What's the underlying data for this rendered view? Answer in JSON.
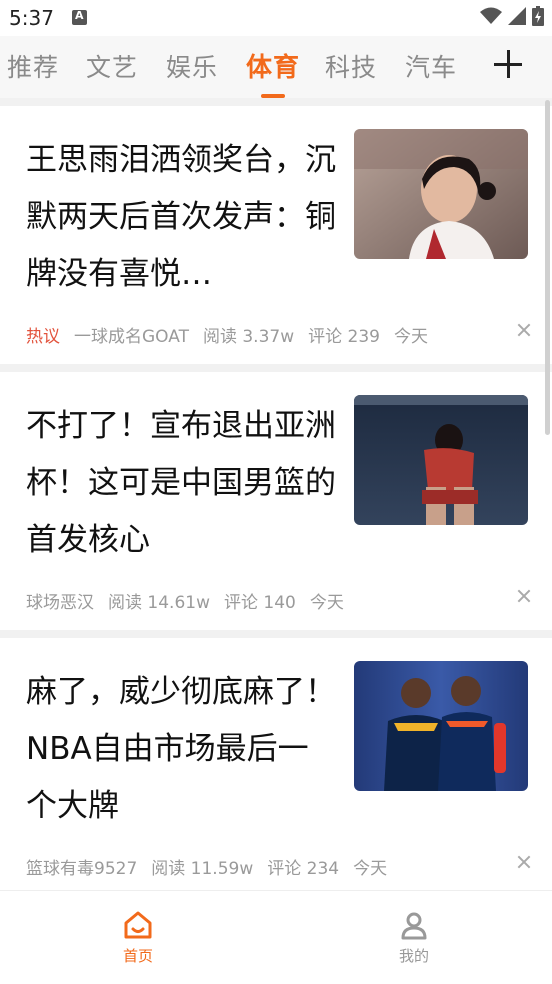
{
  "status": {
    "time": "5:37"
  },
  "tabs": [
    {
      "label": "推荐",
      "active": false
    },
    {
      "label": "文艺",
      "active": false
    },
    {
      "label": "娱乐",
      "active": false
    },
    {
      "label": "体育",
      "active": true
    },
    {
      "label": "科技",
      "active": false
    },
    {
      "label": "汽车",
      "active": false
    }
  ],
  "articles": [
    {
      "title": "王思雨泪洒领奖台，沉默两天后首次发声：铜牌没有喜悦…",
      "tag": "热议",
      "source": "一球成名GOAT",
      "reads": "阅读 3.37w",
      "comments": "评论 239",
      "time": "今天",
      "image": "basketball-player-photo"
    },
    {
      "title": "不打了！宣布退出亚洲杯！这可是中国男篮的首发核心",
      "tag": "",
      "source": "球场恶汉",
      "reads": "阅读 14.61w",
      "comments": "评论 140",
      "time": "今天",
      "image": "basketball-player-sitting-photo"
    },
    {
      "title": "麻了，威少彻底麻了！NBA自由市场最后一个大牌",
      "tag": "",
      "source": "篮球有毒9527",
      "reads": "阅读 11.59w",
      "comments": "评论 234",
      "time": "今天",
      "image": "nba-players-photo"
    }
  ],
  "bottom_nav": {
    "home_label": "首页",
    "me_label": "我的"
  },
  "colors": {
    "accent": "#f26a1b",
    "hot": "#e2533d"
  }
}
